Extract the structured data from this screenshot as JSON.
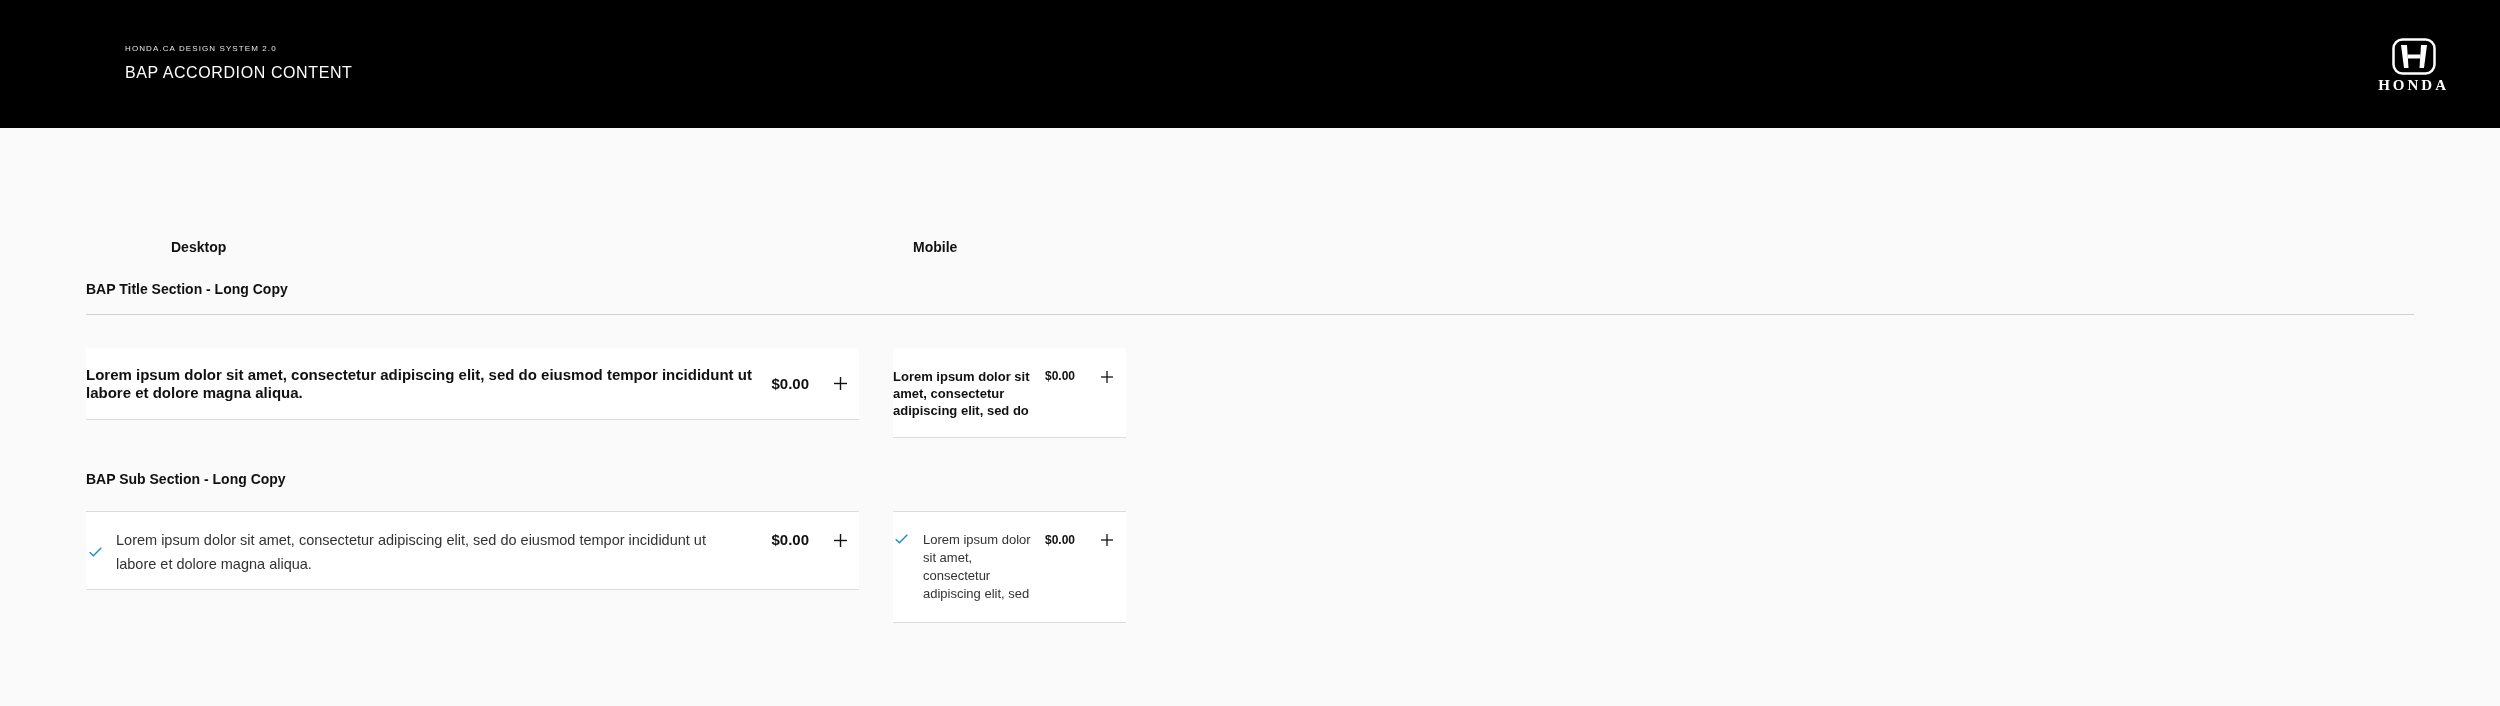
{
  "header": {
    "eyebrow": "HONDA.CA DESIGN SYSTEM 2.0",
    "title": "BAP ACCORDION CONTENT",
    "logo_text": "HONDA"
  },
  "columns": [
    {
      "label": "Desktop"
    },
    {
      "label": "Mobile"
    }
  ],
  "sections": [
    {
      "kind": "title",
      "heading": "BAP Title Section - Long Copy",
      "desktop": {
        "text": "Lorem ipsum dolor sit amet, consectetur adipiscing elit, sed do eiusmod tempor incididunt ut labore et dolore magna aliqua.",
        "price": "$0.00",
        "expanded": false
      },
      "mobile": {
        "text": "Lorem ipsum dolor sit amet, consectetur adipiscing elit, sed do",
        "price": "$0.00",
        "expanded": false
      }
    },
    {
      "kind": "sub",
      "heading": "BAP Sub Section - Long Copy",
      "desktop": {
        "checked": true,
        "text": "Lorem ipsum dolor sit amet, consectetur adipiscing elit, sed do eiusmod tempor incididunt ut labore et dolore magna aliqua.",
        "price": "$0.00",
        "expanded": false
      },
      "mobile": {
        "checked": true,
        "text": "Lorem ipsum dolor sit amet, consectetur adipiscing elit, sed",
        "price": "$0.00",
        "expanded": false
      }
    }
  ]
}
